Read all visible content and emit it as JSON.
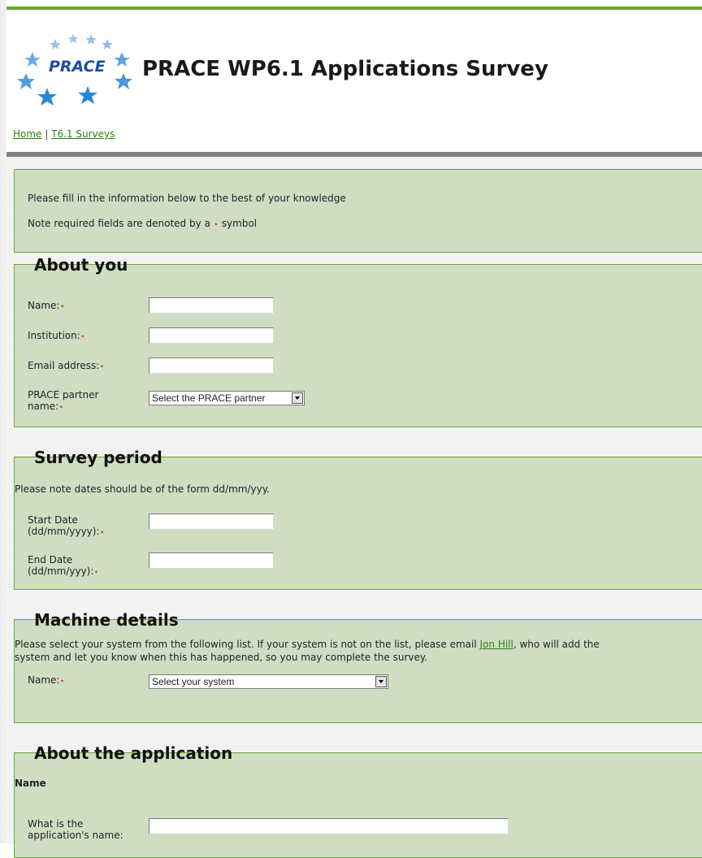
{
  "header": {
    "logo_text": "PRACE",
    "title": "PRACE WP6.1 Applications Survey",
    "breadcrumb": {
      "home": "Home",
      "separator": "|",
      "surveys": "T6.1 Surveys"
    }
  },
  "intro": {
    "line1": "Please fill in the information below to the best of your knowledge",
    "line2_before": "Note required fields are denoted by a",
    "required_symbol": "⋆",
    "line2_after": "symbol"
  },
  "about_you": {
    "legend": "About you",
    "name_label": "Name:",
    "institution_label": "Institution:",
    "email_label": "Email address:",
    "partner_label": "PRACE partner name:",
    "partner_select": "Select the PRACE partner"
  },
  "survey_period": {
    "legend": "Survey period",
    "note": "Please note dates should be of the form dd/mm/yyy.",
    "start_label": "Start Date (dd/mm/yyyy):",
    "end_label": "End Date (dd/mm/yyy):"
  },
  "machine": {
    "legend": "Machine details",
    "text_before": "Please select your system from the following list. If your system is not on the list, please email",
    "link": "Jon Hill",
    "text_after": ", who will add the",
    "text_line2": "system and let you know when this has happened, so you may complete the survey.",
    "name_label": "Name:",
    "system_select": "Select your system"
  },
  "application": {
    "legend": "About the application",
    "section": "Name",
    "app_name_label": "What is the application's name:"
  },
  "colors": {
    "accent": "#6aa62e",
    "box_bg": "#d0ddc3",
    "required": "#e01010"
  }
}
